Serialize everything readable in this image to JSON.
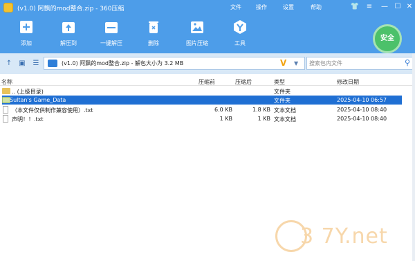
{
  "window": {
    "title": "(v1.0) 阿飘的mod整合.zip - 360压缩",
    "menu": [
      "文件",
      "操作",
      "设置",
      "帮助"
    ]
  },
  "toolbar": {
    "items": [
      {
        "label": "添加",
        "icon": "add-icon"
      },
      {
        "label": "解压到",
        "icon": "extract-to-icon"
      },
      {
        "label": "一键解压",
        "icon": "one-click-extract-icon"
      },
      {
        "label": "删除",
        "icon": "delete-icon"
      },
      {
        "label": "图片压缩",
        "icon": "image-compress-icon"
      },
      {
        "label": "工具",
        "icon": "tools-icon"
      }
    ],
    "safe_badge": "安全"
  },
  "address": {
    "path": "(v1.0) 阿飘的mod整合.zip - 解包大小为 3.2 MB",
    "search_placeholder": "搜索包内文件"
  },
  "columns": {
    "name": "名称",
    "before": "压缩前",
    "after": "压缩后",
    "type": "类型",
    "date": "修改日期"
  },
  "files": [
    {
      "name": ".. (上级目录)",
      "before": "",
      "after": "",
      "type": "文件夹",
      "date": "",
      "icon": "folder-icon"
    },
    {
      "name": "Sultan's Game_Data",
      "before": "",
      "after": "",
      "type": "文件夹",
      "date": "2025-04-10 06:57",
      "icon": "folder-icon"
    },
    {
      "name": "（本文件仅供制作兼容使用）.txt",
      "before": "6.0 KB",
      "after": "1.8 KB",
      "type": "文本文档",
      "date": "2025-04-10 08:40",
      "icon": "text-file-icon"
    },
    {
      "name": "声明！！.txt",
      "before": "1 KB",
      "after": "1 KB",
      "type": "文本文档",
      "date": "2025-04-10 08:40",
      "icon": "text-file-icon"
    }
  ],
  "watermark": "3 7Y.net",
  "colors": {
    "titlebar": "#4d9de9",
    "selection": "#1f6fd3",
    "safe": "#4cc16a"
  }
}
